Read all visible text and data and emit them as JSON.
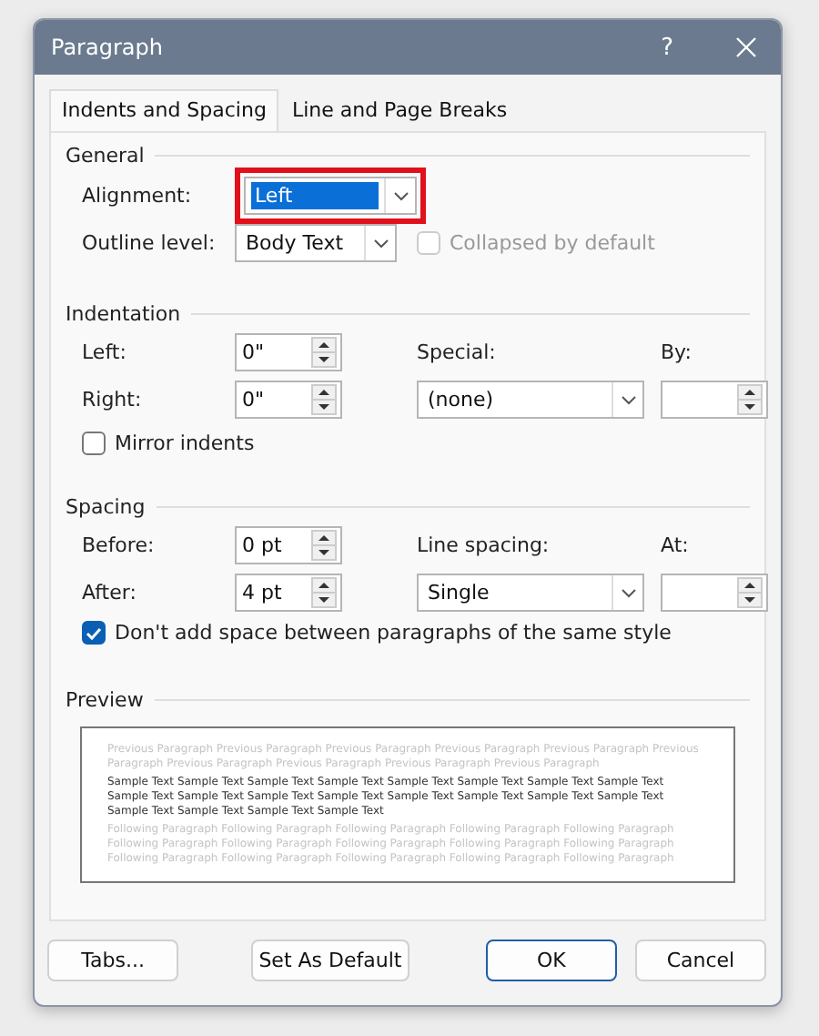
{
  "window": {
    "title": "Paragraph",
    "help": "?"
  },
  "tabs": [
    {
      "label": "Indents and Spacing",
      "selected": true
    },
    {
      "label": "Line and Page Breaks",
      "selected": false
    }
  ],
  "general": {
    "heading": "General",
    "alignment": {
      "label": "Alignment:",
      "value": "Left",
      "highlighted": true,
      "text_selected": true
    },
    "outline_level": {
      "label": "Outline level:",
      "value": "Body Text"
    },
    "collapsed": {
      "label": "Collapsed by default",
      "checked": false,
      "disabled": true
    }
  },
  "indentation": {
    "heading": "Indentation",
    "left": {
      "label": "Left:",
      "value": "0\""
    },
    "right": {
      "label": "Right:",
      "value": "0\""
    },
    "special": {
      "label": "Special:",
      "value": "(none)"
    },
    "by": {
      "label": "By:"
    },
    "mirror": {
      "label": "Mirror indents",
      "checked": false,
      "disabled": false
    }
  },
  "spacing": {
    "heading": "Spacing",
    "before": {
      "label": "Before:",
      "value": "0 pt"
    },
    "after": {
      "label": "After:",
      "value": "4 pt"
    },
    "line_spacing": {
      "label": "Line spacing:",
      "value": "Single"
    },
    "at": {
      "label": "At:"
    },
    "dont_add": {
      "label": "Don't add space between paragraphs of the same style",
      "checked": true,
      "disabled": false
    }
  },
  "preview": {
    "heading": "Preview",
    "paragraphs": [
      {
        "kind": "context",
        "text": "Previous Paragraph Previous Paragraph Previous Paragraph Previous Paragraph Previous Paragraph Previous Paragraph Previous Paragraph Previous Paragraph Previous Paragraph Previous Paragraph"
      },
      {
        "kind": "sample",
        "text": "Sample Text Sample Text Sample Text Sample Text Sample Text Sample Text Sample Text Sample Text Sample Text Sample Text Sample Text Sample Text Sample Text Sample Text Sample Text Sample Text Sample Text Sample Text Sample Text Sample Text"
      },
      {
        "kind": "context",
        "text": "Following Paragraph Following Paragraph Following Paragraph Following Paragraph Following Paragraph Following Paragraph Following Paragraph Following Paragraph Following Paragraph Following Paragraph Following Paragraph Following Paragraph Following Paragraph Following Paragraph Following Paragraph"
      }
    ]
  },
  "buttons": [
    {
      "label": "Tabs...",
      "kind": "normal"
    },
    {
      "label": "Set As Default",
      "kind": "normal"
    },
    {
      "label": "OK",
      "kind": "default"
    },
    {
      "label": "Cancel",
      "kind": "normal"
    }
  ]
}
